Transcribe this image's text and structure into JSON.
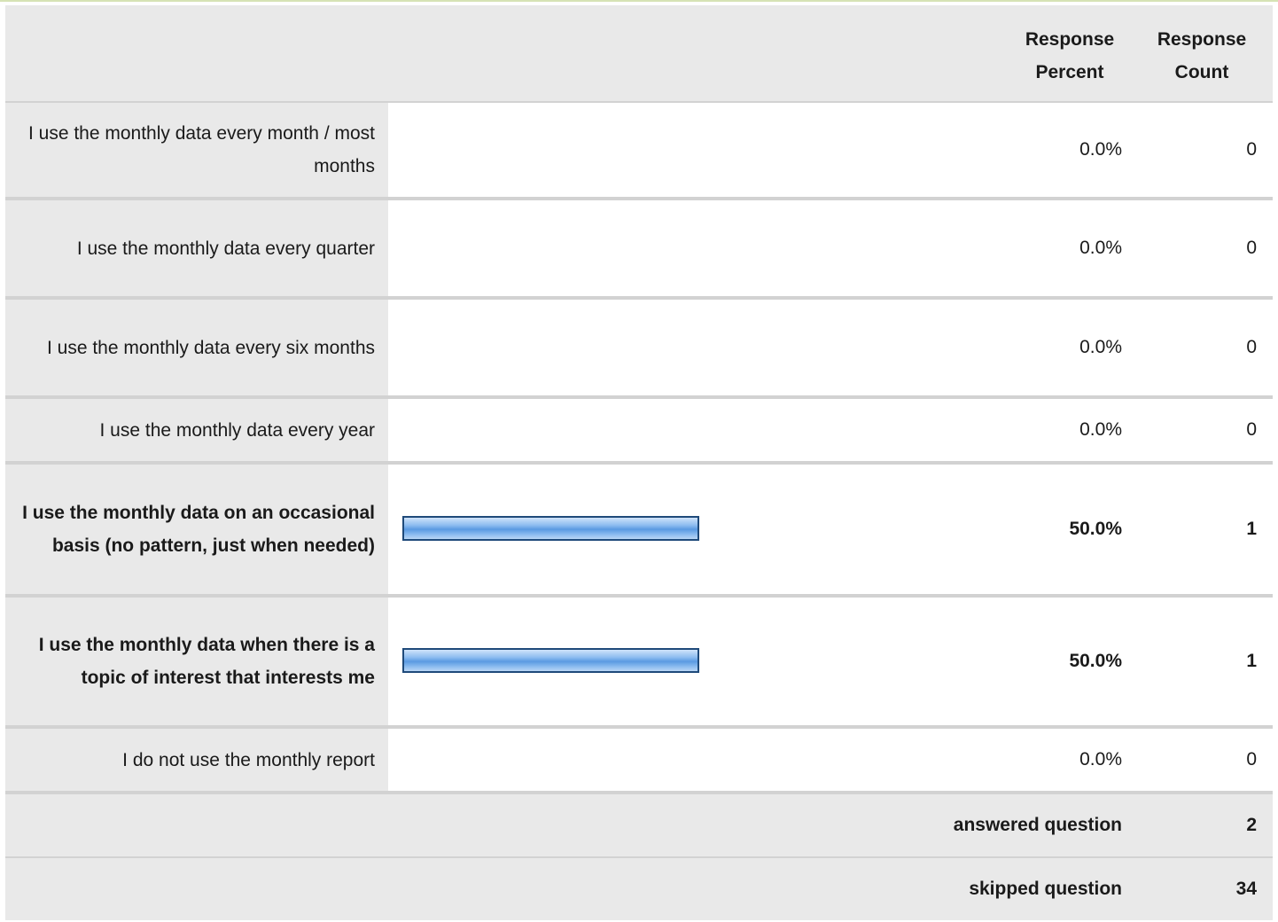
{
  "header": {
    "response_percent": "Response Percent",
    "response_count": "Response Count"
  },
  "colors": {
    "bar": "#5a9ae2",
    "bar_border": "#1f4a7a",
    "label_bg": "#e9e9e9"
  },
  "chart_data": {
    "type": "bar",
    "orientation": "horizontal",
    "xlim": [
      0,
      100
    ],
    "categories": [
      "I use the monthly data every month / most months",
      "I use the monthly data every quarter",
      "I use the monthly data every six months",
      "I use the monthly data every year",
      "I use the monthly data on an occasional basis (no pattern, just when needed)",
      "I use the monthly data when there is a topic of interest that interests me",
      "I do not use the monthly report"
    ],
    "values": [
      0.0,
      0.0,
      0.0,
      0.0,
      50.0,
      50.0,
      0.0
    ],
    "percent_labels": [
      "0.0%",
      "0.0%",
      "0.0%",
      "0.0%",
      "50.0%",
      "50.0%",
      "0.0%"
    ],
    "counts": [
      "0",
      "0",
      "0",
      "0",
      "1",
      "1",
      "0"
    ]
  },
  "footer": {
    "answered_label": "answered question",
    "answered_count": "2",
    "skipped_label": "skipped question",
    "skipped_count": "34"
  }
}
